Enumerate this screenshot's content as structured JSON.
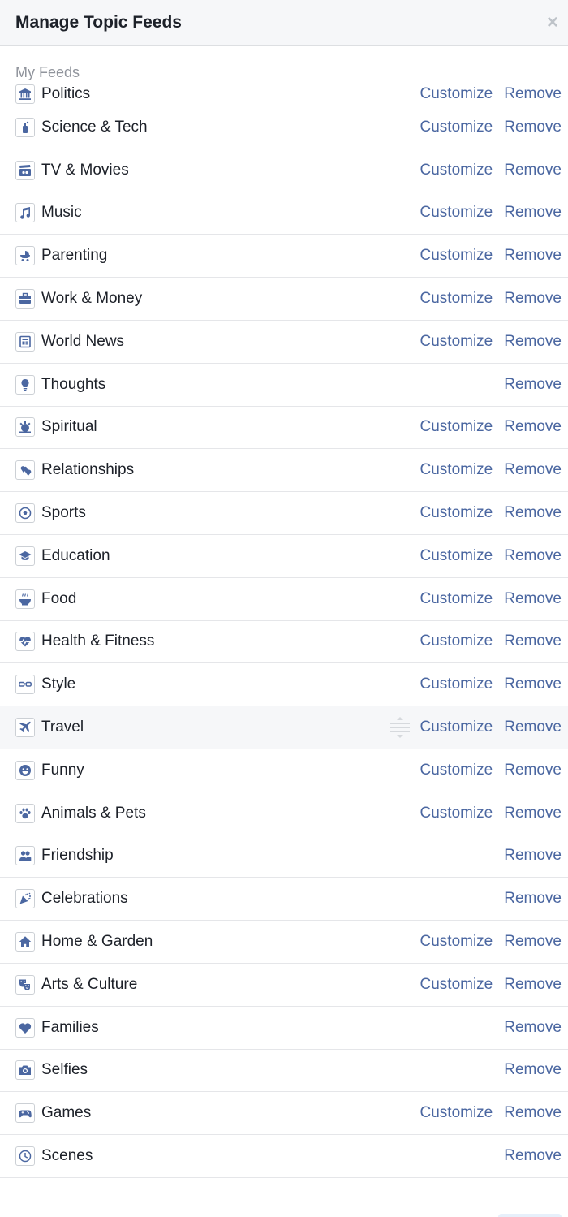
{
  "header": {
    "title": "Manage Topic Feeds",
    "close_glyph": "×"
  },
  "section": {
    "label": "My Feeds"
  },
  "actions": {
    "customize": "Customize",
    "remove": "Remove"
  },
  "colors": {
    "link": "#4b67a1",
    "icon": "#4b67a1",
    "header_bg": "#f6f7f9"
  },
  "feeds": [
    {
      "label": "Politics",
      "icon": "politics-icon",
      "customize": true
    },
    {
      "label": "Science & Tech",
      "icon": "science-tech-icon",
      "customize": true
    },
    {
      "label": "TV & Movies",
      "icon": "tv-movies-icon",
      "customize": true
    },
    {
      "label": "Music",
      "icon": "music-icon",
      "customize": true
    },
    {
      "label": "Parenting",
      "icon": "parenting-icon",
      "customize": true
    },
    {
      "label": "Work & Money",
      "icon": "work-money-icon",
      "customize": true
    },
    {
      "label": "World News",
      "icon": "world-news-icon",
      "customize": true
    },
    {
      "label": "Thoughts",
      "icon": "thoughts-icon",
      "customize": false
    },
    {
      "label": "Spiritual",
      "icon": "spiritual-icon",
      "customize": true
    },
    {
      "label": "Relationships",
      "icon": "relationships-icon",
      "customize": true
    },
    {
      "label": "Sports",
      "icon": "sports-icon",
      "customize": true
    },
    {
      "label": "Education",
      "icon": "education-icon",
      "customize": true
    },
    {
      "label": "Food",
      "icon": "food-icon",
      "customize": true
    },
    {
      "label": "Health & Fitness",
      "icon": "health-fitness-icon",
      "customize": true
    },
    {
      "label": "Style",
      "icon": "style-icon",
      "customize": true
    },
    {
      "label": "Travel",
      "icon": "travel-icon",
      "customize": true,
      "hover": true
    },
    {
      "label": "Funny",
      "icon": "funny-icon",
      "customize": true
    },
    {
      "label": "Animals & Pets",
      "icon": "animals-pets-icon",
      "customize": true
    },
    {
      "label": "Friendship",
      "icon": "friendship-icon",
      "customize": false
    },
    {
      "label": "Celebrations",
      "icon": "celebrations-icon",
      "customize": false
    },
    {
      "label": "Home & Garden",
      "icon": "home-garden-icon",
      "customize": true
    },
    {
      "label": "Arts & Culture",
      "icon": "arts-culture-icon",
      "customize": true
    },
    {
      "label": "Families",
      "icon": "families-icon",
      "customize": false
    },
    {
      "label": "Selfies",
      "icon": "selfies-icon",
      "customize": false
    },
    {
      "label": "Games",
      "icon": "games-icon",
      "customize": true
    },
    {
      "label": "Scenes",
      "icon": "scenes-icon",
      "customize": false
    }
  ]
}
